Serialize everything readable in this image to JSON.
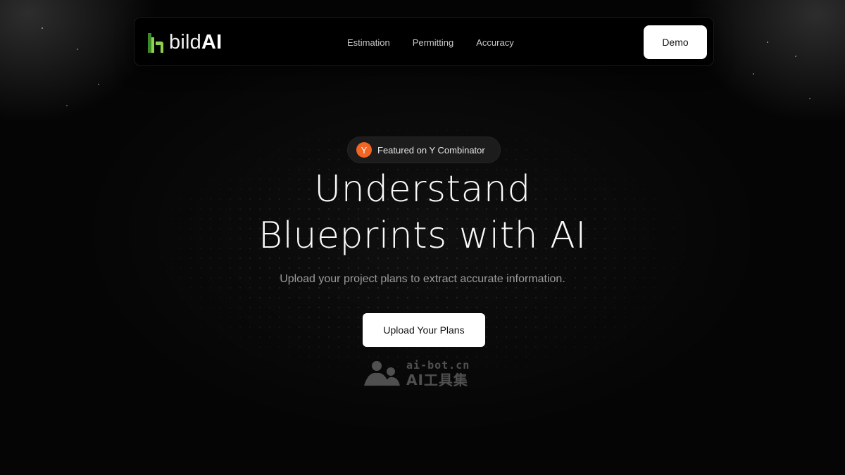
{
  "brand": {
    "name_light": "bild",
    "name_bold": "AI",
    "logo_icon": "building-bars-icon",
    "colors": {
      "logo_green_dark": "#3a8a2a",
      "logo_green_light": "#8fd14f"
    }
  },
  "nav": {
    "links": [
      "Estimation",
      "Permitting",
      "Accuracy"
    ],
    "demo_label": "Demo"
  },
  "hero": {
    "badge_icon_letter": "Y",
    "badge_text": "Featured on Y Combinator",
    "headline_line1": "Understand",
    "headline_line2": "Blueprints with AI",
    "subtitle": "Upload your project plans to extract accurate information.",
    "cta_label": "Upload Your Plans"
  },
  "watermark": {
    "url": "ai-bot.cn",
    "name": "AI工具集"
  },
  "colors": {
    "background": "#050505",
    "yc_orange": "#f26522",
    "button_bg": "#ffffff"
  }
}
